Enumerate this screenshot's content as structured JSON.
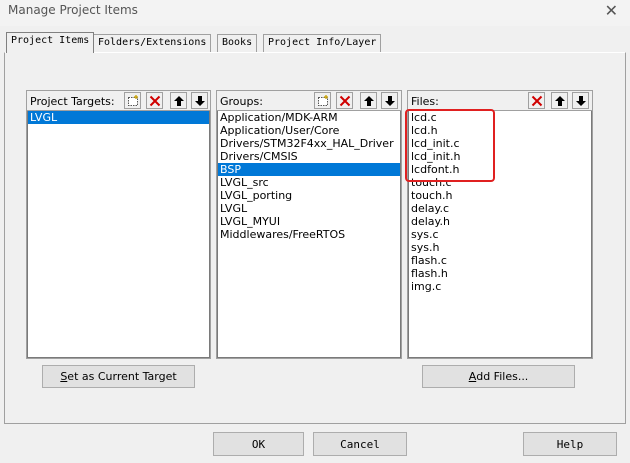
{
  "window": {
    "title": "Manage Project Items",
    "close_glyph": "✕"
  },
  "tabs": [
    {
      "label": "Project Items",
      "active": true
    },
    {
      "label": "Folders/Extensions",
      "active": false
    },
    {
      "label": "Books",
      "active": false
    },
    {
      "label": "Project Info/Layer",
      "active": false
    }
  ],
  "targets": {
    "label": "Project Targets:",
    "items": [
      "LVGL"
    ],
    "selected_index": 0,
    "tools": [
      "new-icon",
      "delete-icon",
      "move-up-icon",
      "move-down-icon"
    ]
  },
  "groups": {
    "label": "Groups:",
    "items": [
      "Application/MDK-ARM",
      "Application/User/Core",
      "Drivers/STM32F4xx_HAL_Driver",
      "Drivers/CMSIS",
      "BSP",
      "LVGL_src",
      "LVGL_porting",
      "LVGL",
      "LVGL_MYUI",
      "Middlewares/FreeRTOS"
    ],
    "selected_index": 4,
    "tools": [
      "new-icon",
      "delete-icon",
      "move-up-icon",
      "move-down-icon"
    ]
  },
  "files": {
    "label": "Files:",
    "items": [
      "lcd.c",
      "lcd.h",
      "lcd_init.c",
      "lcd_init.h",
      "lcdfont.h",
      "touch.c",
      "touch.h",
      "delay.c",
      "delay.h",
      "sys.c",
      "sys.h",
      "flash.c",
      "flash.h",
      "img.c"
    ],
    "highlighted_count": 5,
    "tools": [
      "delete-icon",
      "move-up-icon",
      "move-down-icon"
    ]
  },
  "buttons": {
    "set_target_prefix": "S",
    "set_target_rest": "et as Current Target",
    "add_files_prefix": "A",
    "add_files_rest": "dd Files...",
    "ok": "OK",
    "cancel": "Cancel",
    "help": "Help"
  },
  "colors": {
    "selection": "#0078d7",
    "highlight_box": "#e02020"
  }
}
